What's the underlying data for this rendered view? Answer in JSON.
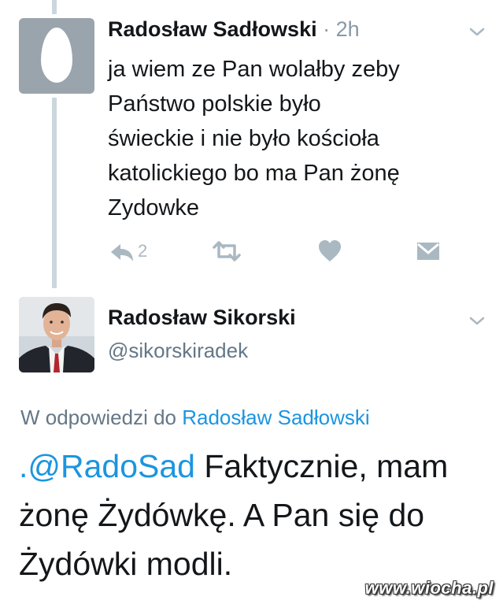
{
  "tweet1": {
    "author_name": "Radosław Sadłowski",
    "time": "· 2h",
    "text_lines": [
      "ja wiem ze Pan wolałby zeby",
      "Państwo polskie było",
      "świeckie i nie było kościoła",
      "katolickiego bo ma Pan żonę",
      "Zydowke"
    ],
    "reply_count": "2",
    "icons": [
      "reply-icon",
      "retweet-icon",
      "like-icon",
      "message-icon",
      "chevron-down-icon",
      "default-egg-avatar"
    ]
  },
  "tweet2": {
    "author_name": "Radosław Sikorski",
    "handle": "@sikorskiradek",
    "reply_to_prefix": "W odpowiedzi do",
    "reply_to_name": "Radosław Sadłowski",
    "mention": ".@RadoSad",
    "text_first_line_rest": " Faktycznie, mam",
    "text_lines": [
      "żonę Żydówkę.  A Pan się do",
      "Żydówki modli."
    ]
  },
  "watermark": "www.wiocha.pl",
  "colors": {
    "link": "#1b95e0",
    "secondary_text": "#657786",
    "icon": "#aab8c2",
    "thread_line": "#ccd6dd"
  }
}
